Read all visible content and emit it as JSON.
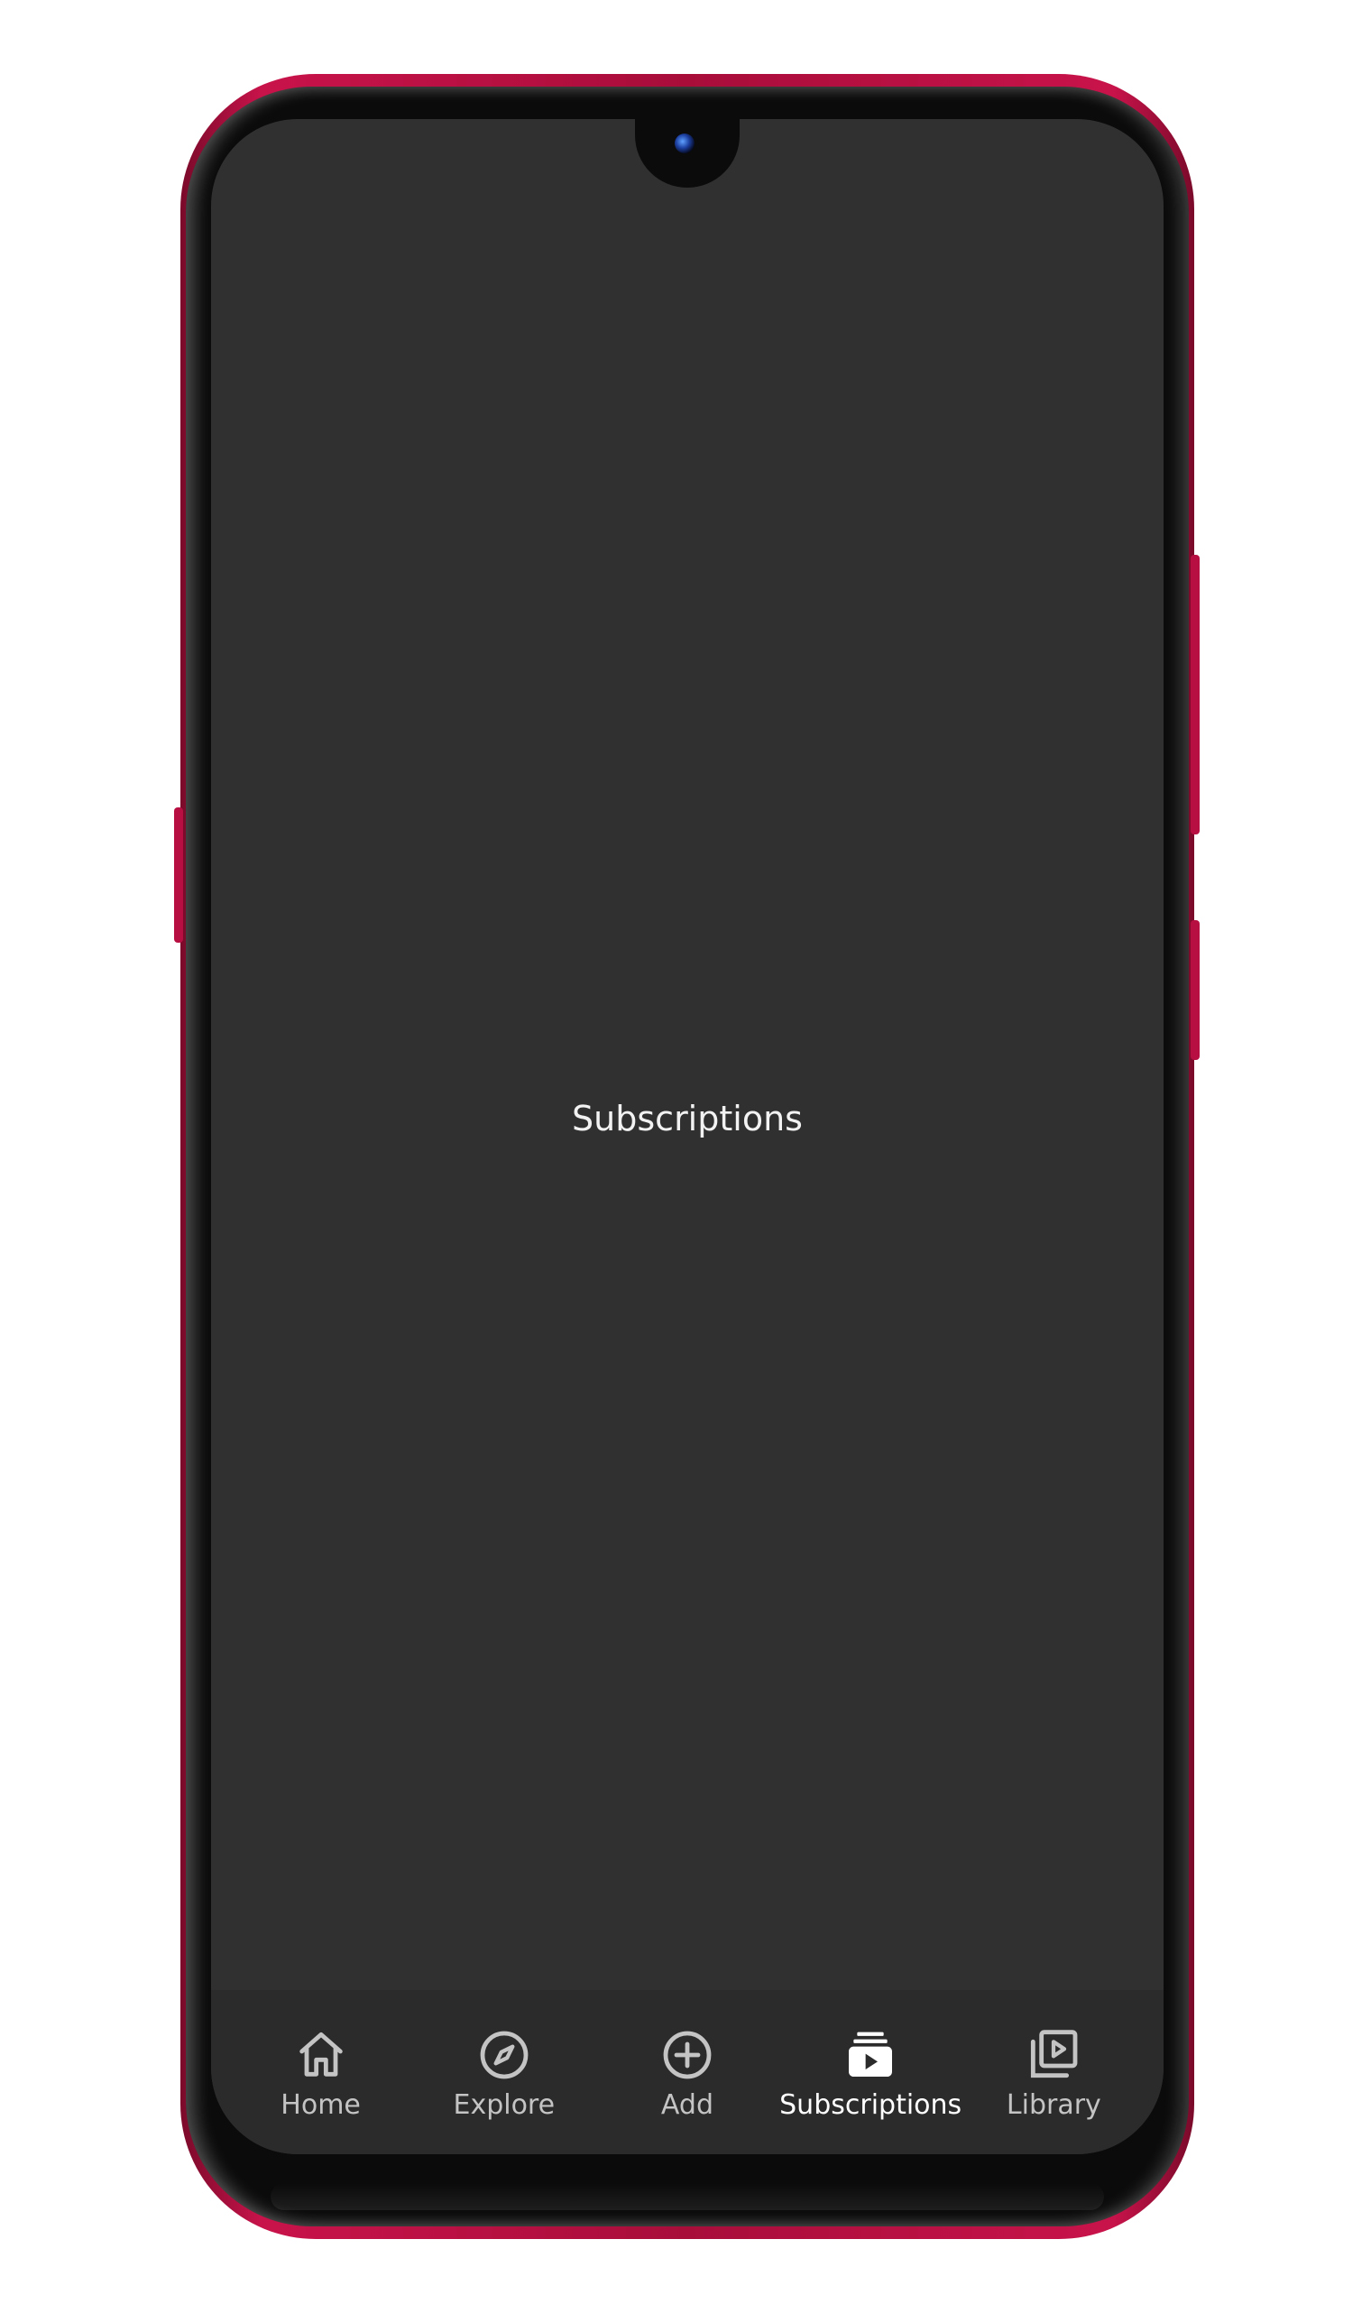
{
  "screen": {
    "title": "Subscriptions"
  },
  "bottom_nav": {
    "active": "Subscriptions",
    "items": [
      {
        "label": "Home",
        "icon": "home-icon"
      },
      {
        "label": "Explore",
        "icon": "compass-icon"
      },
      {
        "label": "Add",
        "icon": "add-circle-icon"
      },
      {
        "label": "Subscriptions",
        "icon": "subscriptions-icon"
      },
      {
        "label": "Library",
        "icon": "library-icon"
      }
    ]
  },
  "colors": {
    "screen_background": "#303030",
    "nav_background": "#2b2b2b",
    "active_text": "#ffffff",
    "inactive_text": "#c4c4c4",
    "phone_frame": "#c8134a"
  }
}
